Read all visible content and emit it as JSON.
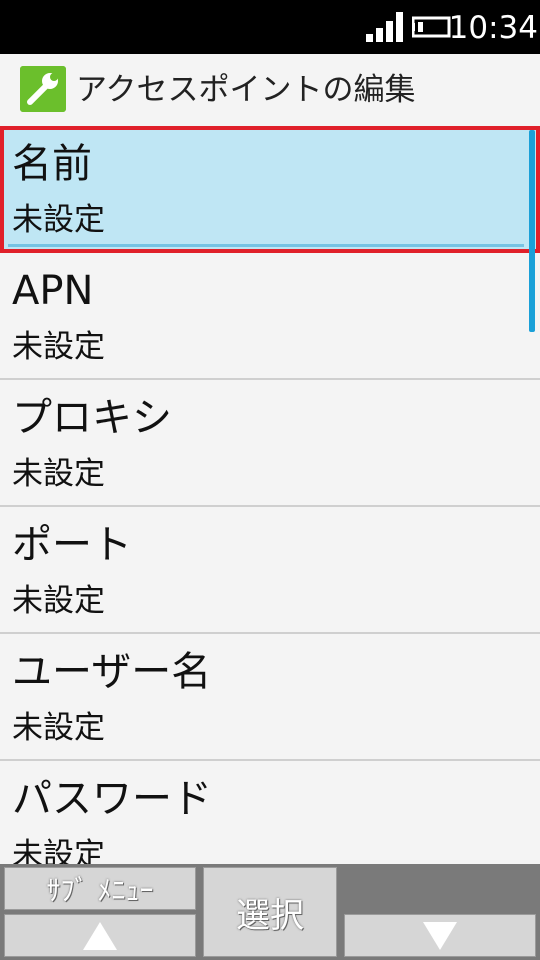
{
  "status_bar": {
    "time": "10:34",
    "icons": [
      "signal-icon",
      "battery-icon"
    ]
  },
  "header": {
    "icon": "wrench-icon",
    "title": "アクセスポイントの編集"
  },
  "list": {
    "items": [
      {
        "title": "名前",
        "value": "未設定",
        "selected": true
      },
      {
        "title": "APN",
        "value": "未設定",
        "selected": false
      },
      {
        "title": "プロキシ",
        "value": "未設定",
        "selected": false
      },
      {
        "title": "ポート",
        "value": "未設定",
        "selected": false
      },
      {
        "title": "ユーザー名",
        "value": "未設定",
        "selected": false
      },
      {
        "title": "パスワード",
        "value": "未設定",
        "selected": false
      }
    ]
  },
  "softkeys": {
    "submenu_label": "ｻﾌﾞ ﾒﾆｭｰ",
    "select_label": "選択",
    "up_icon": "arrow-up-icon",
    "down_icon": "arrow-down-icon"
  },
  "colors": {
    "selection_bg": "#bfe6f4",
    "selection_border": "#e0202a",
    "scrollbar": "#1aa0d8",
    "icon_green": "#6bbf2c"
  }
}
